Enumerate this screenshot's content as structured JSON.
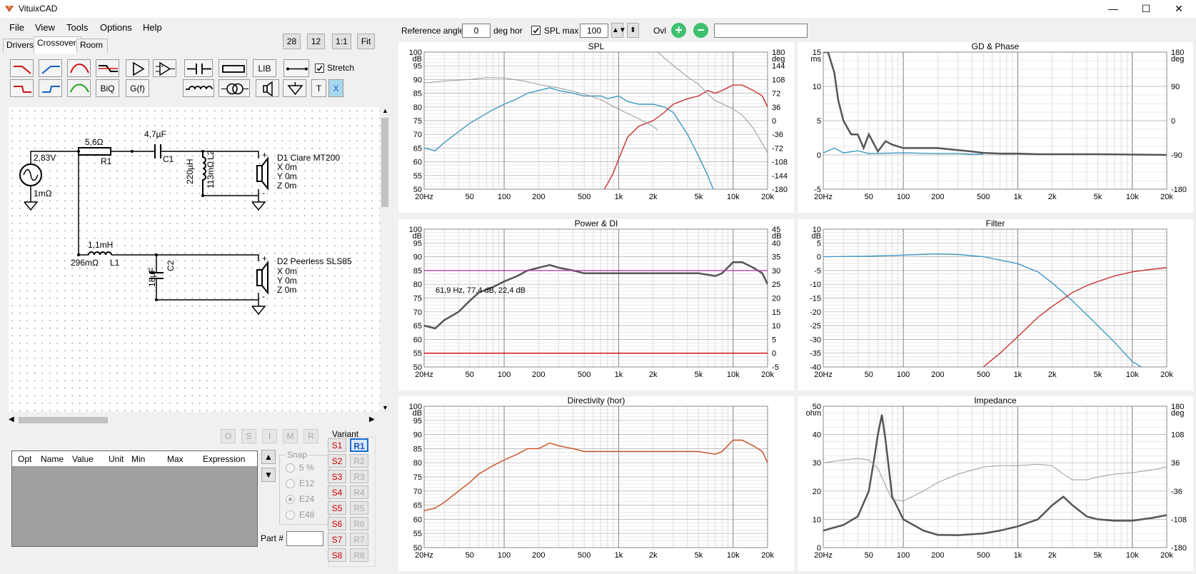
{
  "app": {
    "title": "VituixCAD"
  },
  "menu": [
    "File",
    "View",
    "Tools",
    "Options",
    "Help"
  ],
  "tabs": [
    "Drivers",
    "Crossover",
    "Room"
  ],
  "zoom_buttons": [
    "28",
    "12",
    "1:1",
    "Fit"
  ],
  "toolbar": {
    "lib": "LIB",
    "biq": "BiQ",
    "gf": "G(f)",
    "t": "T",
    "x": "X",
    "stretch_label": "Stretch",
    "stretch_checked": true
  },
  "schematic": {
    "source": {
      "voltage": "2,83V",
      "impedance": "1mΩ"
    },
    "r1": {
      "value": "5,6Ω",
      "name": "R1"
    },
    "c1": {
      "value": "4,7µF",
      "name": "C1"
    },
    "l2": {
      "value": "220µH",
      "esr": "113mΩ",
      "name": "L2"
    },
    "d1": {
      "name": "D1 Ciare MT200",
      "x": "X 0m",
      "y": "Y 0m",
      "z": "Z 0m"
    },
    "l1": {
      "value": "1,1mH",
      "esr": "296mΩ",
      "name": "L1"
    },
    "c2": {
      "value": "18µF",
      "name": "C2"
    },
    "d2": {
      "name": "D2 Peerless SLS85",
      "x": "X 0m",
      "y": "Y 0m",
      "z": "Z 0m"
    }
  },
  "opt_buttons": [
    "O",
    "S",
    "I",
    "M",
    "R"
  ],
  "table_headers": [
    "Opt",
    "Name",
    "Value",
    "Unit",
    "Min",
    "Max",
    "Expression"
  ],
  "snap": {
    "label": "Snap",
    "options": [
      "5 %",
      "E12",
      "E24",
      "E48"
    ],
    "selected": "E24"
  },
  "part_label": "Part #",
  "variant": {
    "label": "Variant",
    "s": [
      "S1",
      "S2",
      "S3",
      "S4",
      "S5",
      "S6",
      "S7",
      "S8"
    ],
    "r": [
      "R1",
      "R2",
      "R3",
      "R4",
      "R5",
      "R6",
      "R7",
      "R8"
    ],
    "active": "R1"
  },
  "topbar": {
    "ref_angle_label": "Reference angle",
    "ref_angle_value": "0",
    "deg_hor": "deg hor",
    "spl_max_label": "SPL max",
    "spl_max_value": "100",
    "ovl": "Ovl",
    "spl_max_checked": true
  },
  "colors": {
    "blue": "#3f97c4",
    "red": "#c83232",
    "gray": "#555555",
    "purple": "#b040b0",
    "darkred": "#cc0000",
    "orange": "#c84a1e"
  },
  "chart_data": [
    {
      "type": "line",
      "title": "SPL",
      "xlabel": "",
      "ylabel": "dB",
      "y2label": "deg",
      "xscale": "log",
      "xlim": [
        20,
        20000
      ],
      "ylim": [
        50,
        100
      ],
      "y2lim": [
        -180,
        180
      ],
      "xticks": [
        "20Hz",
        "50",
        "100",
        "200",
        "500",
        "1k",
        "2k",
        "5k",
        "10k",
        "20k"
      ],
      "yticks": [
        "100",
        "95",
        "90",
        "85",
        "80",
        "75",
        "70",
        "65",
        "60",
        "55",
        "50"
      ],
      "y2ticks": [
        "180",
        "144",
        "108",
        "72",
        "36",
        "0",
        "-36",
        "-72",
        "-108",
        "-144",
        "-180"
      ],
      "series": [
        {
          "color": "#3f97c4",
          "x": [
            20,
            25,
            30,
            40,
            50,
            60,
            80,
            100,
            130,
            160,
            200,
            250,
            300,
            400,
            500,
            600,
            700,
            800,
            1000,
            1200,
            1500,
            2000,
            2500,
            3000,
            4000,
            5000,
            6000,
            7000
          ],
          "y": [
            65,
            64,
            67,
            71,
            74,
            76,
            79,
            81,
            83,
            85,
            86,
            87,
            86,
            85,
            84,
            84,
            84,
            83,
            84,
            82,
            81,
            81,
            80,
            78,
            70,
            62,
            55,
            48
          ]
        },
        {
          "color": "#c83232",
          "x": [
            700,
            800,
            900,
            1000,
            1200,
            1500,
            2000,
            2500,
            3000,
            4000,
            5000,
            6000,
            7000,
            8000,
            10000,
            12000,
            15000,
            18000,
            20000
          ],
          "y": [
            48,
            52,
            56,
            61,
            69,
            73,
            75,
            78,
            81,
            83,
            84,
            86,
            85,
            86,
            88,
            88,
            86,
            84,
            80
          ]
        },
        {
          "color": "#999999",
          "x": [
            20,
            30,
            50,
            70,
            100,
            150,
            200,
            300,
            500,
            700,
            1000,
            1500,
            2000,
            2200
          ],
          "y": [
            99,
            104,
            108,
            113,
            112,
            104,
            95,
            86,
            70,
            55,
            30,
            5,
            -15,
            -25
          ]
        },
        {
          "color": "#999999",
          "x": [
            2100,
            2500,
            3000,
            4000,
            5000,
            6000,
            7000,
            8000,
            10000,
            12000,
            15000,
            18000,
            20000
          ],
          "y": [
            185,
            165,
            145,
            115,
            95,
            70,
            52,
            45,
            30,
            15,
            -20,
            -60,
            -85
          ]
        }
      ]
    },
    {
      "type": "line",
      "title": "GD & Phase",
      "xlabel": "",
      "ylabel": "ms",
      "y2label": "deg",
      "xscale": "log",
      "xlim": [
        20,
        20000
      ],
      "ylim": [
        -5,
        15
      ],
      "y2lim": [
        -180,
        180
      ],
      "xticks": [
        "20Hz",
        "50",
        "100",
        "200",
        "500",
        "1k",
        "2k",
        "5k",
        "10k",
        "20k"
      ],
      "yticks": [
        "15",
        "10",
        "5",
        "0",
        "-5"
      ],
      "y2ticks": [
        "180",
        "90",
        "0",
        "-90",
        "-180"
      ],
      "series": [
        {
          "color": "#555555",
          "x": [
            20,
            22,
            25,
            27,
            30,
            35,
            40,
            45,
            50,
            60,
            70,
            80,
            100,
            150,
            200,
            300,
            400,
            500,
            700,
            1000,
            1500,
            2000,
            5000,
            20000
          ],
          "y": [
            15,
            15,
            12,
            8,
            5,
            3,
            3,
            1,
            3,
            0.5,
            2,
            1.5,
            1,
            1,
            1,
            0.7,
            0.5,
            0.3,
            0.2,
            0.2,
            0.1,
            0.1,
            0.1,
            0
          ]
        },
        {
          "color": "#3f97c4",
          "x": [
            20,
            25,
            30,
            40,
            50,
            100,
            200,
            300,
            400,
            500
          ],
          "y": [
            0.3,
            1,
            0.3,
            0.6,
            0.2,
            0.3,
            0.2,
            0.2,
            0.1,
            0.1
          ]
        }
      ]
    },
    {
      "type": "line",
      "title": "Power & DI",
      "xlabel": "",
      "ylabel": "dB",
      "y2label": "dB",
      "xscale": "log",
      "xlim": [
        20,
        20000
      ],
      "ylim": [
        50,
        100
      ],
      "y2lim": [
        -5,
        45
      ],
      "annotation": "61,9 Hz, 77,4 dB, 22,4 dB",
      "xticks": [
        "20Hz",
        "50",
        "100",
        "200",
        "500",
        "1k",
        "2k",
        "5k",
        "10k",
        "20k"
      ],
      "yticks": [
        "100",
        "95",
        "90",
        "85",
        "80",
        "75",
        "70",
        "65",
        "60",
        "55",
        "50"
      ],
      "y2ticks": [
        "45",
        "40",
        "35",
        "30",
        "25",
        "20",
        "15",
        "10",
        "5",
        "0",
        "-5"
      ],
      "series": [
        {
          "color": "#555555",
          "x": [
            20,
            25,
            30,
            40,
            50,
            60,
            80,
            100,
            130,
            160,
            200,
            250,
            300,
            400,
            500,
            700,
            1000,
            1500,
            2000,
            3000,
            5000,
            7000,
            8000,
            10000,
            12000,
            15000,
            18000,
            20000
          ],
          "y": [
            65,
            64,
            67,
            70,
            74,
            77,
            79,
            81,
            83,
            85,
            86,
            87,
            86,
            85,
            84,
            84,
            84,
            84,
            84,
            84,
            84,
            83,
            84,
            88,
            88,
            86,
            84,
            80
          ]
        },
        {
          "color": "#b040b0",
          "x": [
            20,
            20000
          ],
          "y": [
            85,
            85
          ]
        },
        {
          "color": "#cc0000",
          "x": [
            20,
            20000
          ],
          "y": [
            55,
            55
          ]
        }
      ]
    },
    {
      "type": "line",
      "title": "Filter",
      "xlabel": "",
      "ylabel": "dB",
      "xscale": "log",
      "xlim": [
        20,
        20000
      ],
      "ylim": [
        -40,
        10
      ],
      "xticks": [
        "20Hz",
        "50",
        "100",
        "200",
        "500",
        "1k",
        "2k",
        "5k",
        "10k",
        "20k"
      ],
      "yticks": [
        "10",
        "5",
        "0",
        "-5",
        "-10",
        "-15",
        "-20",
        "-25",
        "-30",
        "-35",
        "-40"
      ],
      "series": [
        {
          "color": "#3f97c4",
          "x": [
            20,
            50,
            100,
            200,
            300,
            500,
            700,
            1000,
            1500,
            2000,
            2500,
            3000,
            4000,
            5000,
            7000,
            10000,
            12000
          ],
          "y": [
            0,
            0.2,
            0.6,
            1,
            0.8,
            0,
            -1.2,
            -2.5,
            -5.5,
            -9.5,
            -13,
            -16,
            -21,
            -25,
            -31,
            -38,
            -40
          ]
        },
        {
          "color": "#c83232",
          "x": [
            500,
            700,
            1000,
            1500,
            2000,
            3000,
            4000,
            5000,
            7000,
            10000,
            15000,
            20000
          ],
          "y": [
            -40,
            -35,
            -29,
            -22,
            -18,
            -13,
            -10.5,
            -9,
            -7,
            -5.5,
            -4.5,
            -4
          ]
        }
      ]
    },
    {
      "type": "line",
      "title": "Directivity (hor)",
      "xlabel": "",
      "ylabel": "dB",
      "xscale": "log",
      "xlim": [
        20,
        20000
      ],
      "ylim": [
        50,
        100
      ],
      "xticks": [
        "20Hz",
        "50",
        "100",
        "200",
        "500",
        "1k",
        "2k",
        "5k",
        "10k",
        "20k"
      ],
      "yticks": [
        "100",
        "95",
        "90",
        "85",
        "80",
        "75",
        "70",
        "65",
        "60",
        "55",
        "50"
      ],
      "series": [
        {
          "color": "#c84a1e",
          "x": [
            20,
            25,
            30,
            40,
            50,
            60,
            80,
            100,
            130,
            160,
            200,
            250,
            300,
            400,
            500,
            700,
            1000,
            1500,
            2000,
            3000,
            5000,
            7000,
            8000,
            10000,
            12000,
            15000,
            18000,
            20000
          ],
          "y": [
            63,
            64,
            66,
            70,
            73,
            76,
            79,
            81,
            83,
            85,
            85,
            87,
            86,
            85,
            84,
            84,
            84,
            84,
            84,
            84,
            84,
            83,
            84,
            88,
            88,
            86,
            84,
            80
          ]
        }
      ]
    },
    {
      "type": "line",
      "title": "Impedance",
      "xlabel": "",
      "ylabel": "ohm",
      "y2label": "deg",
      "xscale": "log",
      "xlim": [
        20,
        20000
      ],
      "ylim": [
        0,
        50
      ],
      "y2lim": [
        -180,
        180
      ],
      "xticks": [
        "20Hz",
        "50",
        "100",
        "200",
        "500",
        "1k",
        "2k",
        "5k",
        "10k",
        "20k"
      ],
      "yticks": [
        "50",
        "40",
        "30",
        "20",
        "10",
        "0"
      ],
      "y2ticks": [
        "180",
        "108",
        "36",
        "-36",
        "-108",
        "-180"
      ],
      "series": [
        {
          "color": "#555555",
          "x": [
            20,
            30,
            40,
            50,
            55,
            60,
            65,
            70,
            80,
            100,
            150,
            200,
            300,
            500,
            700,
            1000,
            1500,
            2000,
            2500,
            3000,
            4000,
            5000,
            7000,
            10000,
            15000,
            20000
          ],
          "y": [
            6,
            8,
            11,
            20,
            30,
            40,
            47,
            38,
            18,
            10,
            6,
            4.5,
            4.4,
            5,
            6,
            7.5,
            10,
            15,
            18,
            15,
            11,
            10,
            9.5,
            9.5,
            10.5,
            11.5
          ]
        },
        {
          "color": "#999999",
          "x": [
            20,
            30,
            40,
            50,
            60,
            70,
            80,
            100,
            150,
            200,
            300,
            500,
            700,
            1000,
            1500,
            2000,
            2500,
            3000,
            4000,
            5000,
            7000,
            10000,
            15000,
            20000
          ],
          "y": [
            30,
            31,
            31.5,
            31,
            28,
            22,
            17,
            16.5,
            20,
            23,
            26,
            28.5,
            29,
            29,
            29.5,
            29,
            26,
            24,
            24,
            25,
            26,
            26.5,
            27.5,
            28.5
          ]
        }
      ]
    }
  ]
}
